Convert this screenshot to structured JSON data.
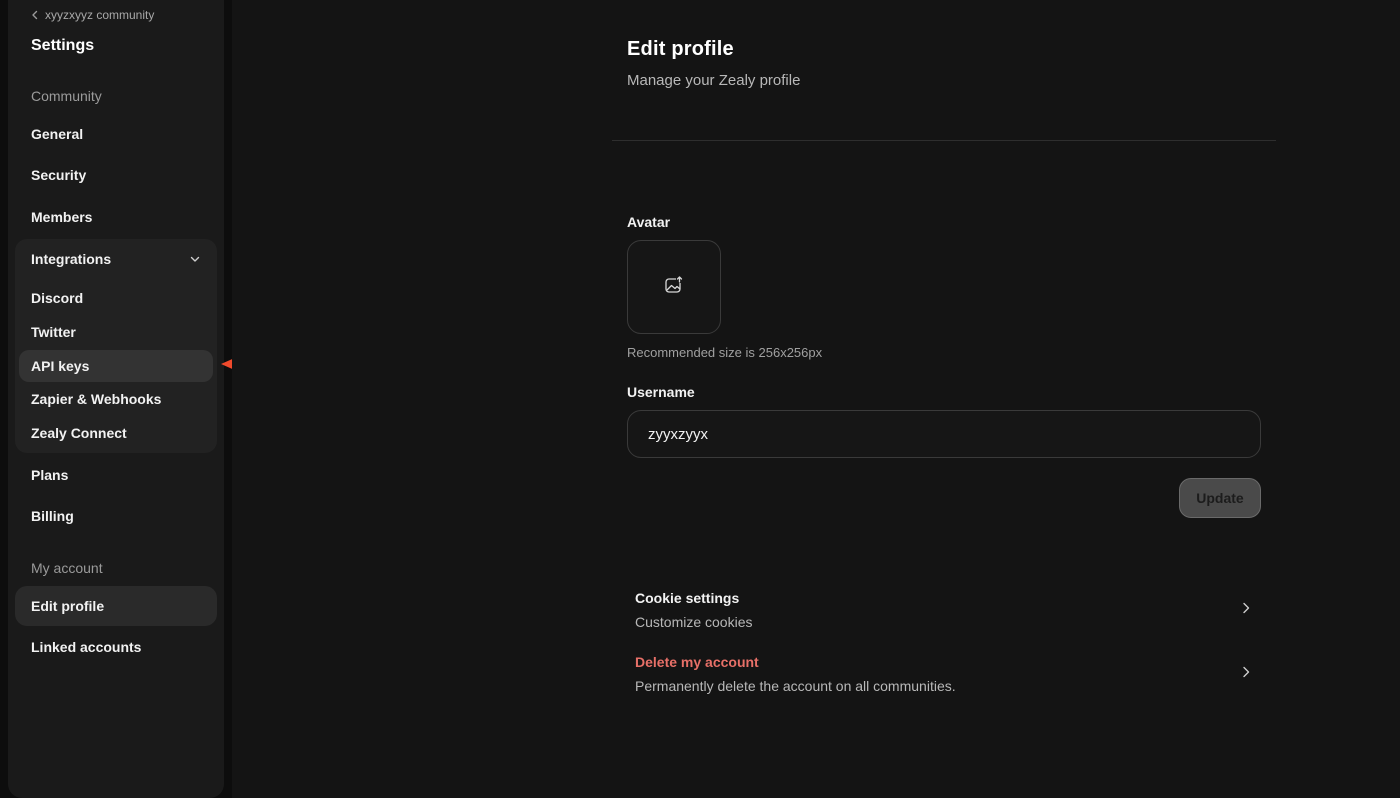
{
  "sidebar": {
    "back_label": "xyyzxyyz community",
    "title": "Settings",
    "community_section": "Community",
    "items": {
      "general": "General",
      "security": "Security",
      "members": "Members",
      "integrations": "Integrations",
      "plans": "Plans",
      "billing": "Billing"
    },
    "integrations_sub": {
      "discord": "Discord",
      "twitter": "Twitter",
      "api_keys": "API keys",
      "zapier": "Zapier & Webhooks",
      "zealy_connect": "Zealy Connect"
    },
    "account_section": "My account",
    "account_items": {
      "edit_profile": "Edit profile",
      "linked_accounts": "Linked accounts"
    },
    "active_item": "Edit profile",
    "highlighted_sub_item": "API keys"
  },
  "main": {
    "title": "Edit profile",
    "subtitle": "Manage your Zealy profile",
    "avatar_label": "Avatar",
    "avatar_hint": "Recommended size is 256x256px",
    "username_label": "Username",
    "username_value": "zyyxzyyx",
    "update_label": "Update",
    "cookie_title": "Cookie settings",
    "cookie_desc": "Customize cookies",
    "delete_title": "Delete my account",
    "delete_desc": "Permanently delete the account on all communities."
  },
  "icons": {
    "back": "chevron-left-icon",
    "integrations_toggle": "chevron-down-icon",
    "avatar_upload": "image-upload-icon",
    "row_chevron": "chevron-right-icon",
    "annotation": "red-arrow-left"
  },
  "colors": {
    "background": "#141414",
    "sidebar": "#1a1a1a",
    "danger": "#e77068",
    "annotation_arrow": "#f04a2c"
  }
}
